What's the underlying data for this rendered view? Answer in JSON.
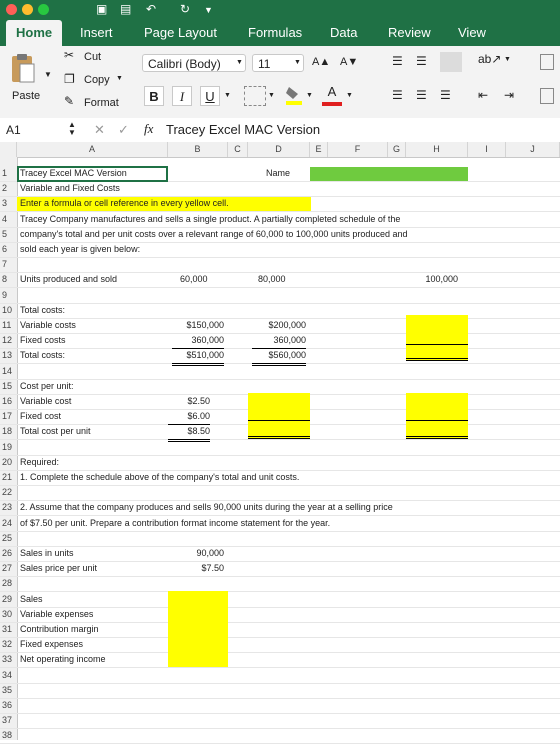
{
  "ribbon": {
    "tabs": [
      "Home",
      "Insert",
      "Page Layout",
      "Formulas",
      "Data",
      "Review",
      "View"
    ],
    "clipboard": {
      "paste": "Paste",
      "cut": "Cut",
      "copy": "Copy",
      "format": "Format"
    },
    "font_name": "Calibri (Body)",
    "font_size": "11",
    "bold": "B",
    "italic": "I",
    "underline": "U",
    "grow": "A▲",
    "shrink": "A▼",
    "font_color": "A"
  },
  "formula_bar": {
    "cell_ref": "A1",
    "fx": "fx",
    "value": "Tracey Excel MAC Version"
  },
  "columns": [
    "A",
    "B",
    "C",
    "D",
    "E",
    "F",
    "G",
    "H",
    "I",
    "J"
  ],
  "rows": [
    "1",
    "2",
    "3",
    "4",
    "5",
    "6",
    "7",
    "8",
    "9",
    "10",
    "11",
    "12",
    "13",
    "14",
    "15",
    "16",
    "17",
    "18",
    "19",
    "20",
    "21",
    "22",
    "23",
    "24",
    "25",
    "26",
    "27",
    "28",
    "29",
    "30",
    "31",
    "32",
    "33",
    "34",
    "35",
    "36",
    "37",
    "38"
  ],
  "cells": {
    "a1": "Tracey Excel MAC Version",
    "d1": "Name",
    "a2": "Variable and Fixed Costs",
    "a3": "Enter a formula or cell reference in every yellow cell.",
    "a4": "Tracey Company manufactures and sells a single product. A partially completed schedule of the",
    "a5": "company's total and per unit costs over a relevant range of 60,000 to 100,000 units produced and",
    "a6": "sold each year is given below:",
    "a8": "Units produced and sold",
    "b8": "60,000",
    "d8": "80,000",
    "h8": "100,000",
    "a10": "Total costs:",
    "a11": "Variable costs",
    "b11": "$150,000",
    "d11": "$200,000",
    "a12": "Fixed costs",
    "b12": "360,000",
    "d12": "360,000",
    "a13": "Total costs:",
    "b13": "$510,000",
    "d13": "$560,000",
    "a15": "Cost per unit:",
    "a16": "Variable cost",
    "b16": "$2.50",
    "a17": "Fixed cost",
    "b17": "$6.00",
    "a18": "Total cost per unit",
    "b18": "$8.50",
    "a20": "Required:",
    "a21": "1. Complete the schedule above of the company's total and unit costs.",
    "a23": "2. Assume that the company produces and sells 90,000 units during the year at a selling price",
    "a24": "of $7.50 per unit. Prepare a contribution format income statement for the year.",
    "a26": "Sales in units",
    "b26": "90,000",
    "a27": "Sales price per unit",
    "b27": "$7.50",
    "a29": "Sales",
    "a30": "Variable expenses",
    "a31": "Contribution margin",
    "a32": "Fixed expenses",
    "a33": "Net operating income"
  },
  "colors": {
    "excel_green": "#1f7145",
    "highlight_yellow": "#ffff00",
    "name_green": "#6fcb3f"
  }
}
